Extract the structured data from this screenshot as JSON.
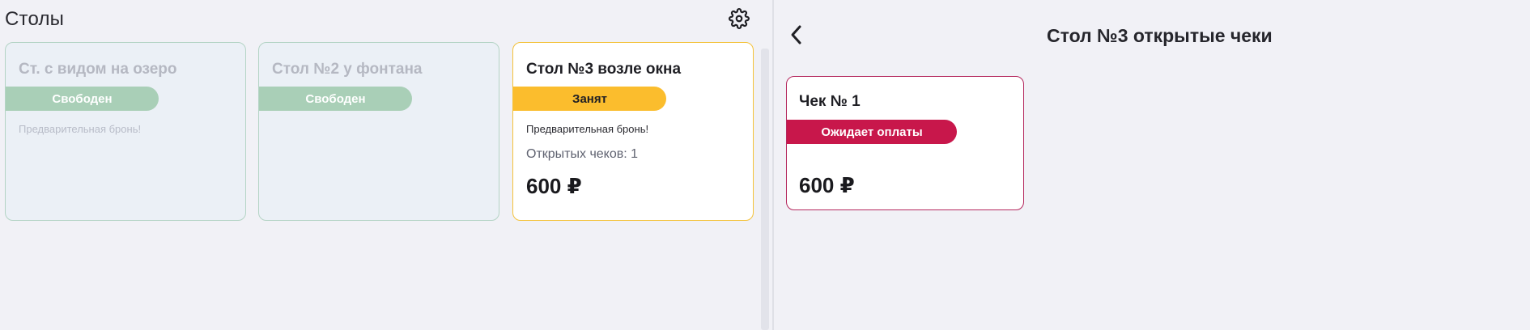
{
  "tables_panel": {
    "title": "Столы",
    "settings_icon": "gear-icon",
    "tables": [
      {
        "name": "Ст. с видом на озеро",
        "status": "Свободен",
        "reserve_note": "Предварительная бронь!"
      },
      {
        "name": "Стол №2 у фонтана",
        "status": "Свободен"
      },
      {
        "name": "Стол №3 возле окна",
        "status": "Занят",
        "reserve_note": "Предварительная бронь!",
        "open_checks": "Открытых чеков: 1",
        "sum": "600 ₽"
      }
    ]
  },
  "checks_panel": {
    "back_icon": "chevron-left-icon",
    "title": "Стол №3 открытые чеки",
    "checks": [
      {
        "name": "Чек № 1",
        "status": "Ожидает оплаты",
        "sum": "600 ₽"
      }
    ]
  },
  "colors": {
    "free_pill": "#a9cfb7",
    "busy_pill": "#fbbd2d",
    "awaiting_payment": "#c8174b",
    "check_border": "#b5285e"
  }
}
